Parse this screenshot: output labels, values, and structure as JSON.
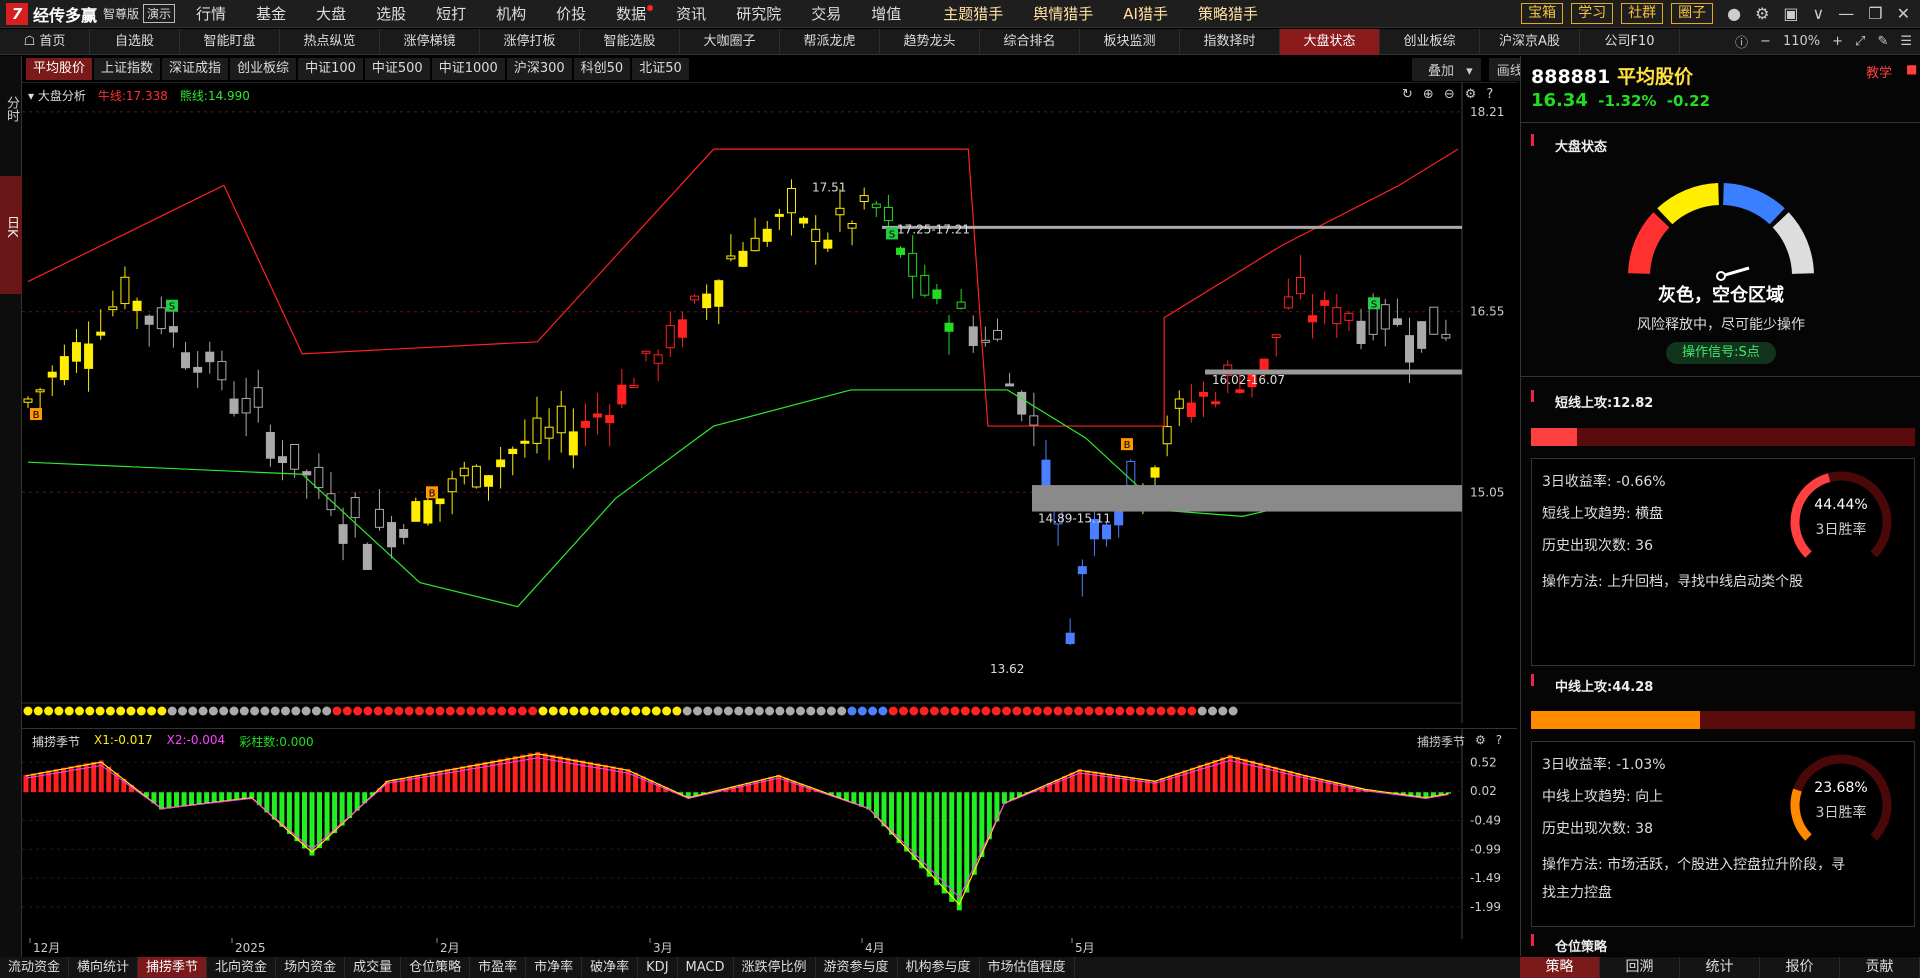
{
  "app": {
    "logo_text": "经传多赢",
    "edition": "智尊版",
    "demo": "演示"
  },
  "top_menu": [
    "行情",
    "基金",
    "大盘",
    "选股",
    "短打",
    "机构",
    "价投",
    "数据",
    "资讯",
    "研究院",
    "交易",
    "增值"
  ],
  "hunter_menu": [
    "主题猎手",
    "舆情猎手",
    "AI猎手",
    "策略猎手"
  ],
  "top_buttons": [
    "宝箱",
    "学习",
    "社群",
    "圈子"
  ],
  "nav_home": "首页",
  "nav_items": [
    "自选股",
    "智能盯盘",
    "热点纵览",
    "涨停梯镜",
    "涨停打板",
    "智能选股",
    "大咖圈子",
    "帮派龙虎",
    "趋势龙头",
    "综合排名",
    "板块监测",
    "指数择时",
    "大盘状态",
    "创业板综",
    "沪深京A股",
    "公司F10"
  ],
  "nav_active": "大盘状态",
  "zoom": "110%",
  "left_labels": {
    "fenshi": "分时",
    "rik": "日K"
  },
  "index_tabs": [
    "平均股价",
    "上证指数",
    "深证成指",
    "创业板综",
    "中证100",
    "中证500",
    "中证1000",
    "沪深300",
    "科创50",
    "北证50"
  ],
  "index_active": "平均股价",
  "overlay_labels": {
    "stack": "叠加",
    "draw": "画线"
  },
  "chart_header": {
    "name": "大盘分析",
    "bull_label": "牛线:17.338",
    "bear_label": "熊线:14.990"
  },
  "colors": {
    "bull": "#ff3030",
    "bear": "#2ee82e",
    "yellow": "#ffee00",
    "red": "#ff2020",
    "green": "#22dd22",
    "blue": "#4a7fff",
    "gray": "#999999"
  },
  "chart_data": {
    "type": "candlestick",
    "price_axis_ticks": [
      "18.21",
      "16.55",
      "15.05"
    ],
    "price_range": [
      13.3,
      18.3
    ],
    "annotations": {
      "high_label": "17.51",
      "high_zone": "17.25-17.21",
      "low_label": "13.62",
      "low_zone": "14.89-15.11",
      "mid_zone": "16.02-16.07"
    },
    "x_labels": [
      "12月",
      "2025",
      "2月",
      "3月",
      "4月",
      "5月"
    ]
  },
  "indicator": {
    "name": "捕捞季节",
    "x1": "X1:-0.017",
    "x2": "X2:-0.004",
    "bars": "彩柱数:0.000",
    "axis_ticks": [
      "0.52",
      "0.02",
      "-0.49",
      "-0.99",
      "-1.49",
      "-1.99"
    ],
    "right_label": "捕捞季节"
  },
  "bottom_tabs": [
    "流动资金",
    "横向统计",
    "捕捞季节",
    "北向资金",
    "场内资金",
    "成交量",
    "仓位策略",
    "市盈率",
    "市净率",
    "破净率",
    "KDJ",
    "MACD",
    "涨跌停比例",
    "游资参与度",
    "机构参与度",
    "市场估值程度"
  ],
  "bottom_active": "捕捞季节",
  "right": {
    "code": "888881",
    "name": "平均股价",
    "teach": "教学",
    "price": "16.34",
    "change_pct": "-1.32%",
    "change": "-0.22",
    "status_title": "大盘状态",
    "status_text": "灰色，空仓区域",
    "status_desc": "风险释放中，尽可能少操作",
    "signal": "操作信号:S点",
    "short": {
      "title": "短线上攻:12.82",
      "progress": 0.12,
      "ret": "3日收益率:  -0.66%",
      "trend": "短线上攻趋势:  横盘",
      "count": "历史出现次数:  36",
      "method": "操作方法:  上升回档，寻找中线启动类个股",
      "winrate_pct": "44.44%",
      "winrate": 0.4444,
      "winrate_label": "3日胜率"
    },
    "mid": {
      "title": "中线上攻:44.28",
      "progress": 0.44,
      "ret": "3日收益率:  -1.03%",
      "trend": "中线上攻趋势:  向上",
      "count": "历史出现次数:  38",
      "method1": "操作方法:  市场活跃，个股进入控盘拉升阶段，寻",
      "method2": "找主力控盘",
      "winrate_pct": "23.68%",
      "winrate": 0.2368,
      "winrate_label": "3日胜率"
    },
    "position_title": "仓位策略",
    "bottom_tabs": [
      "策略",
      "回溯",
      "统计",
      "报价",
      "贡献"
    ],
    "bottom_active": "策略"
  }
}
